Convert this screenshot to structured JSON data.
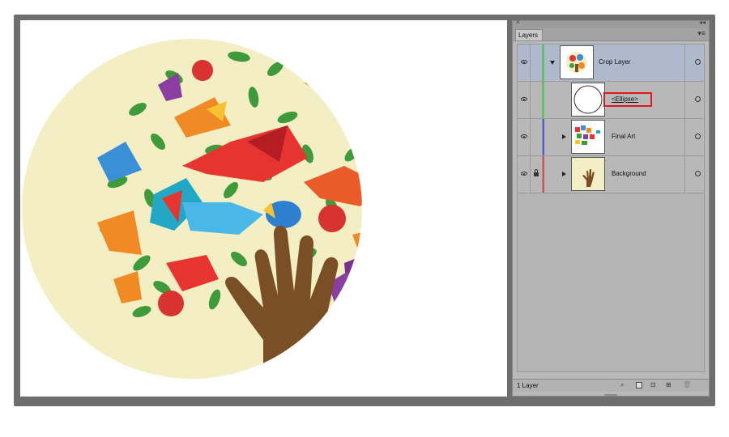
{
  "panel": {
    "tab_label": "Layers",
    "menu_icon": "panel-menu-icon",
    "footer_count": "1 Layer"
  },
  "layers": [
    {
      "name": "Crop Layer",
      "color": "#4bd34b",
      "expanded": true,
      "selected": true,
      "locked": false,
      "visible": true
    },
    {
      "name": "<Ellipse>",
      "color": "#4bd34b",
      "sublayer": true,
      "visible": true
    },
    {
      "name": "Final Art",
      "color": "#4a5bd9",
      "expanded": false,
      "locked": false,
      "visible": true
    },
    {
      "name": "Background",
      "color": "#e14b4b",
      "expanded": false,
      "locked": true,
      "visible": true
    }
  ],
  "colors": {
    "circle_bg": "#f3eec3",
    "hand": "#7a4f26",
    "highlight_box": "#e0191e",
    "selection": "#aeb9cd"
  },
  "footer_icons": [
    "locate-object-icon",
    "make-clipping-mask-icon",
    "new-sublayer-icon",
    "new-layer-icon",
    "delete-layer-icon"
  ]
}
